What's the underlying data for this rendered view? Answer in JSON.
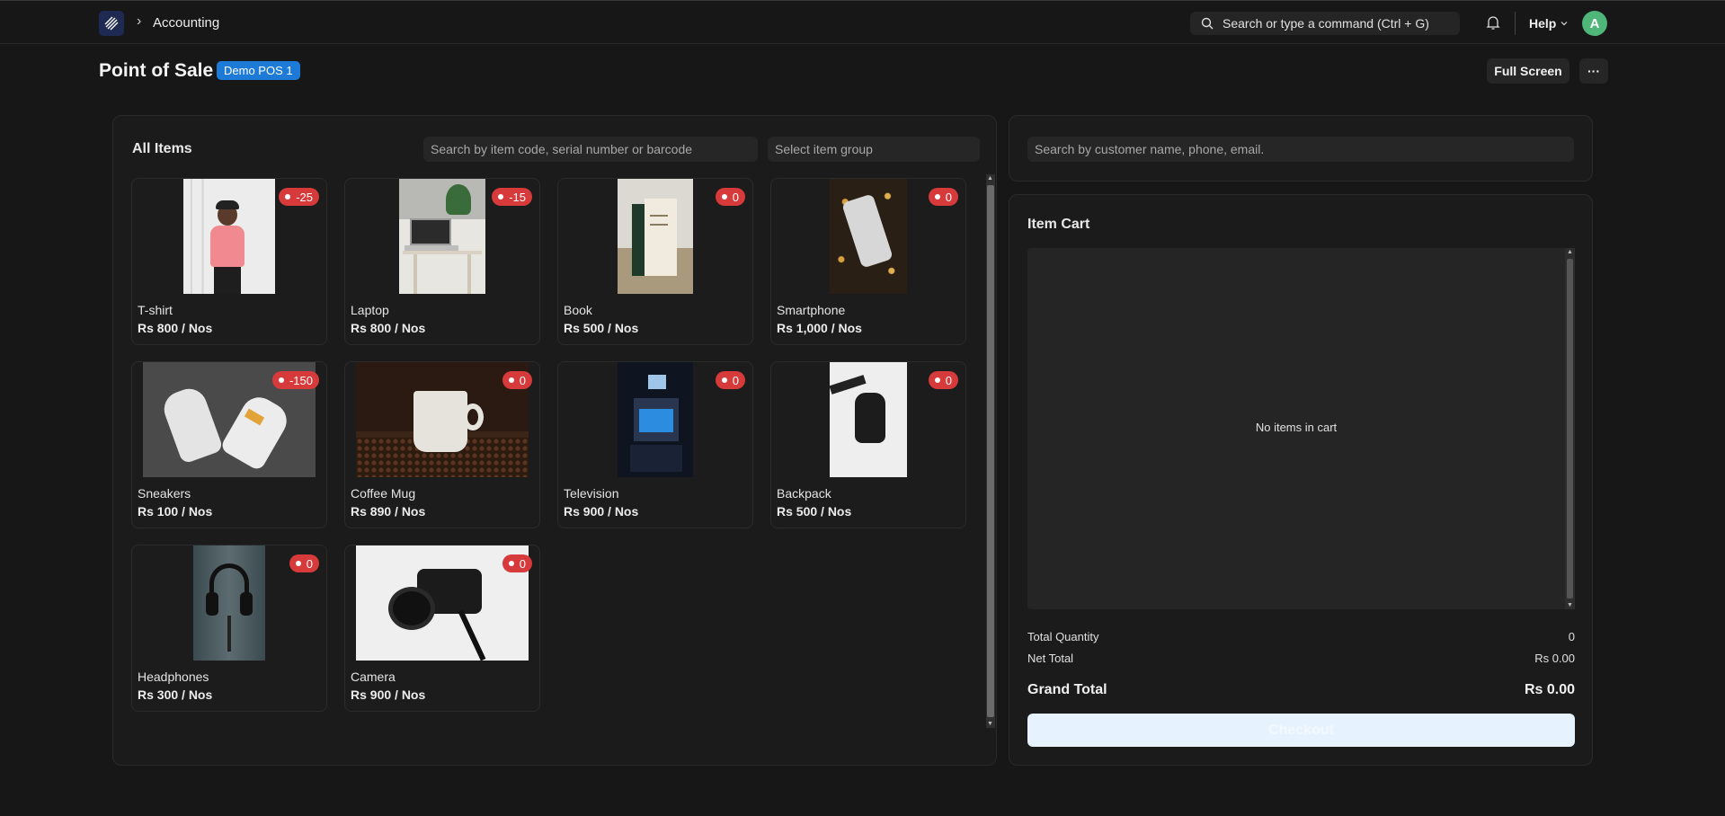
{
  "topbar": {
    "breadcrumb": "Accounting",
    "search_placeholder": "Search or type a command (Ctrl + G)",
    "help_label": "Help",
    "avatar_initial": "A"
  },
  "page": {
    "title": "Point of Sale",
    "pos_profile": "Demo POS 1",
    "fullscreen_label": "Full Screen",
    "more_label": "···"
  },
  "items_panel": {
    "title": "All Items",
    "search_placeholder": "Search by item code, serial number or barcode",
    "group_placeholder": "Select item group",
    "items": [
      {
        "name": "T-shirt",
        "price": "Rs 800 / Nos",
        "stock": "-25",
        "image": "tshirt-photo"
      },
      {
        "name": "Laptop",
        "price": "Rs 800 / Nos",
        "stock": "-15",
        "image": "laptop-photo"
      },
      {
        "name": "Book",
        "price": "Rs 500 / Nos",
        "stock": "0",
        "image": "book-photo"
      },
      {
        "name": "Smartphone",
        "price": "Rs 1,000 / Nos",
        "stock": "0",
        "image": "smartphone-photo"
      },
      {
        "name": "Sneakers",
        "price": "Rs 100 / Nos",
        "stock": "-150",
        "image": "sneakers-photo"
      },
      {
        "name": "Coffee Mug",
        "price": "Rs 890 / Nos",
        "stock": "0",
        "image": "coffee-mug-photo"
      },
      {
        "name": "Television",
        "price": "Rs 900 / Nos",
        "stock": "0",
        "image": "television-photo"
      },
      {
        "name": "Backpack",
        "price": "Rs 500 / Nos",
        "stock": "0",
        "image": "backpack-photo"
      },
      {
        "name": "Headphones",
        "price": "Rs 300 / Nos",
        "stock": "0",
        "image": "headphones-photo"
      },
      {
        "name": "Camera",
        "price": "Rs 900 / Nos",
        "stock": "0",
        "image": "camera-photo"
      }
    ]
  },
  "customer": {
    "search_placeholder": "Search by customer name, phone, email."
  },
  "cart": {
    "title": "Item Cart",
    "empty_message": "No items in cart",
    "total_quantity_label": "Total Quantity",
    "total_quantity_value": "0",
    "net_total_label": "Net Total",
    "net_total_value": "Rs 0.00",
    "grand_total_label": "Grand Total",
    "grand_total_value": "Rs 0.00",
    "checkout_label": "Checkout"
  },
  "colors": {
    "background": "#171717",
    "panel": "#1b1b1b",
    "badge_blue": "#1d7bd7",
    "stock_red": "#d63a3a",
    "avatar_green": "#4fb67a",
    "checkout_bg": "#e6f3ff"
  }
}
